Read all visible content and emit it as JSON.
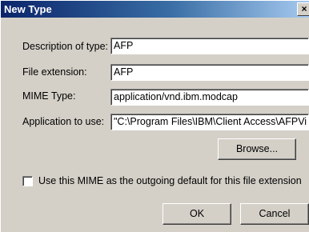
{
  "window": {
    "title": "New Type",
    "close_glyph": "×"
  },
  "fields": {
    "description_label": "Description of type:",
    "description_value": "AFP",
    "extension_label": "File extension:",
    "extension_value": "AFP",
    "mime_label": "MIME Type:",
    "mime_value": "application/vnd.ibm.modcap",
    "app_label": "Application to use:",
    "app_value": "\"C:\\Program Files\\IBM\\Client Access\\AFPVi"
  },
  "buttons": {
    "browse": "Browse...",
    "ok": "OK",
    "cancel": "Cancel"
  },
  "checkbox": {
    "label": "Use this MIME as the outgoing default for this file extension",
    "checked": false
  },
  "colors": {
    "dialog_bg": "#d4d0c8",
    "titlebar_start": "#0a246a",
    "titlebar_end": "#a6caf0",
    "title_text": "#ffffff"
  },
  "icons": {
    "close": "close-icon"
  }
}
